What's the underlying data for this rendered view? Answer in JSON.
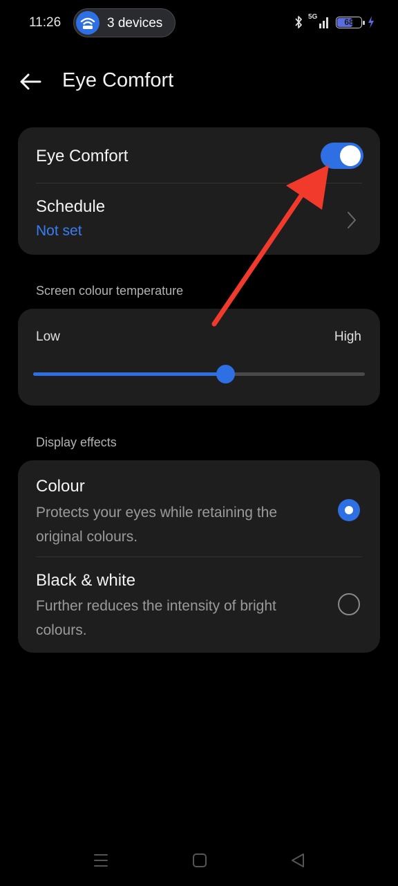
{
  "status_bar": {
    "time": "11:26",
    "devices_label": "3 devices",
    "network": "5G",
    "battery": "68",
    "battery_level_pct": 68
  },
  "header": {
    "title": "Eye Comfort"
  },
  "eye_comfort": {
    "toggle_label": "Eye Comfort",
    "toggle_on": true,
    "schedule_label": "Schedule",
    "schedule_value": "Not set"
  },
  "temperature": {
    "section_label": "Screen colour temperature",
    "low_label": "Low",
    "high_label": "High",
    "value_fraction": 0.58
  },
  "display_effects": {
    "section_label": "Display effects",
    "options": [
      {
        "title": "Colour",
        "description": "Protects your eyes while retaining the original colours.",
        "selected": true
      },
      {
        "title": "Black & white",
        "description": "Further reduces the intensity of bright colours.",
        "selected": false
      }
    ]
  },
  "colors": {
    "accent": "#2f6fe4",
    "annotation_arrow": "#f23a2c",
    "card_background": "#1e1e1f"
  },
  "icons": [
    "wifi-icon",
    "bluetooth-icon",
    "signal-icon",
    "battery-icon",
    "charging-icon",
    "back-arrow-icon",
    "chevron-right-icon",
    "menu-nav-icon",
    "home-nav-icon",
    "back-nav-icon"
  ]
}
